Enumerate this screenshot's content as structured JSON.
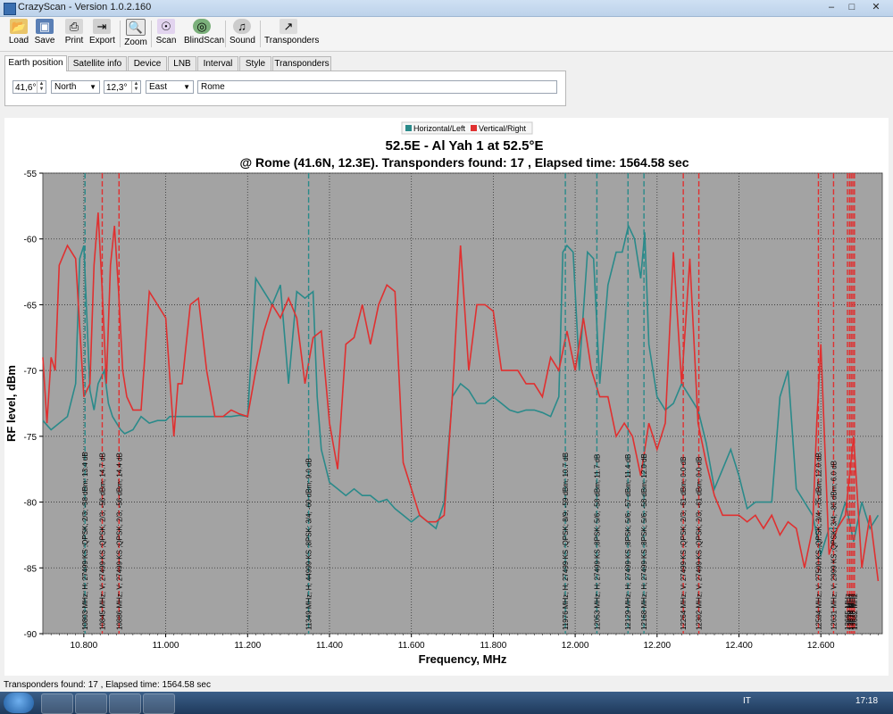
{
  "window": {
    "title": "CrazyScan - Version 1.0.2.160"
  },
  "toolbar": [
    {
      "label": "Load",
      "icon": "folder-icon"
    },
    {
      "label": "Save",
      "icon": "floppy-icon"
    },
    {
      "label": "Print",
      "icon": "printer-icon"
    },
    {
      "label": "Export",
      "icon": "export-icon"
    },
    {
      "label": "Zoom",
      "icon": "zoom-icon"
    },
    {
      "label": "Scan",
      "icon": "scan-icon"
    },
    {
      "label": "BlindScan",
      "icon": "blindscan-icon"
    },
    {
      "label": "Sound",
      "icon": "speaker-icon"
    },
    {
      "label": "Transponders",
      "icon": "transponders-icon"
    }
  ],
  "tabs": [
    "Earth position",
    "Satellite info",
    "Device",
    "LNB",
    "Interval",
    "Style",
    "Transponders"
  ],
  "earth_position": {
    "latitude": "41,6°",
    "lat_dir": "North",
    "longitude": "12,3°",
    "lon_dir": "East",
    "location": "Rome"
  },
  "chart_data": {
    "type": "line",
    "title": "52.5E - Al Yah 1 at 52.5°E",
    "subtitle": "@ Rome (41.6N, 12.3E). Transponders found: 17 , Elapsed time: 1564.58 sec",
    "xlabel": "Frequency, MHz",
    "ylabel": "RF level, dBm",
    "xlim": [
      10700,
      12750
    ],
    "ylim": [
      -90,
      -55
    ],
    "xticks": [
      "10.800",
      "11.000",
      "11.200",
      "11.400",
      "11.600",
      "11.800",
      "12.000",
      "12.200",
      "12.400",
      "12.600"
    ],
    "xtick_values": [
      10800,
      11000,
      11200,
      11400,
      11600,
      11800,
      12000,
      12200,
      12400,
      12600
    ],
    "yticks": [
      -55,
      -60,
      -65,
      -70,
      -75,
      -80,
      -85,
      -90
    ],
    "grid": true,
    "legend": [
      "Horizontal/Left",
      "Vertical/Right"
    ],
    "colors": {
      "horizontal": "#2a8a8a",
      "vertical": "#e03030",
      "plot_bg": "#a3a3a3"
    },
    "series": [
      {
        "name": "Horizontal/Left",
        "color": "#2a8a8a",
        "x": [
          10700,
          10720,
          10740,
          10760,
          10780,
          10790,
          10800,
          10815,
          10825,
          10835,
          10850,
          10860,
          10870,
          10880,
          10890,
          10900,
          10920,
          10940,
          10960,
          10980,
          11000,
          11010,
          11020,
          11040,
          11060,
          11080,
          11100,
          11120,
          11140,
          11160,
          11180,
          11200,
          11220,
          11240,
          11260,
          11280,
          11300,
          11320,
          11340,
          11360,
          11370,
          11380,
          11400,
          11420,
          11440,
          11460,
          11480,
          11500,
          11520,
          11540,
          11560,
          11580,
          11600,
          11620,
          11640,
          11660,
          11680,
          11700,
          11720,
          11740,
          11760,
          11780,
          11800,
          11820,
          11840,
          11860,
          11880,
          11900,
          11920,
          11940,
          11960,
          11970,
          11980,
          11995,
          12010,
          12030,
          12045,
          12060,
          12080,
          12100,
          12115,
          12130,
          12145,
          12160,
          12170,
          12180,
          12200,
          12220,
          12240,
          12260,
          12280,
          12300,
          12320,
          12340,
          12360,
          12380,
          12400,
          12420,
          12440,
          12460,
          12480,
          12500,
          12520,
          12540,
          12560,
          12580,
          12600,
          12620,
          12640,
          12660,
          12680,
          12700,
          12720,
          12740
        ],
        "y": [
          -73.8,
          -74.5,
          -74,
          -73.5,
          -71,
          -61.5,
          -60.5,
          -71.5,
          -73,
          -71,
          -70,
          -72.5,
          -73.5,
          -74,
          -74.5,
          -74.8,
          -74.5,
          -73.5,
          -74,
          -73.8,
          -73.8,
          -73.5,
          -73.5,
          -73.5,
          -73.5,
          -73.5,
          -73.5,
          -73.5,
          -73.5,
          -73.5,
          -73.4,
          -73.5,
          -63,
          -64,
          -65,
          -63.5,
          -71,
          -64,
          -64.5,
          -64,
          -72,
          -76,
          -78.5,
          -79,
          -79.5,
          -79,
          -79.5,
          -79.5,
          -80,
          -79.8,
          -80.5,
          -81,
          -81.5,
          -81,
          -81.5,
          -82,
          -80,
          -72,
          -71,
          -71.5,
          -72.5,
          -72.5,
          -72,
          -72.5,
          -73,
          -73.2,
          -73,
          -73,
          -73.2,
          -73.5,
          -72,
          -61,
          -60.5,
          -61,
          -70,
          -61,
          -61.5,
          -71,
          -63.5,
          -61,
          -61,
          -59,
          -60,
          -63,
          -59.5,
          -68,
          -72,
          -73,
          -72.5,
          -71,
          -72,
          -73,
          -75.5,
          -79,
          -77.5,
          -76,
          -78,
          -80.5,
          -80,
          -80,
          -80,
          -72,
          -70,
          -79,
          -80,
          -81,
          -84,
          -82,
          -82,
          -80,
          -83,
          -80,
          -82,
          -81
        ]
      },
      {
        "name": "Vertical/Right",
        "color": "#e03030",
        "x": [
          10700,
          10710,
          10720,
          10730,
          10740,
          10760,
          10780,
          10800,
          10815,
          10825,
          10835,
          10845,
          10855,
          10865,
          10875,
          10885,
          10895,
          10905,
          10920,
          10940,
          10960,
          10980,
          11000,
          11020,
          11030,
          11040,
          11060,
          11080,
          11100,
          11120,
          11140,
          11160,
          11180,
          11200,
          11220,
          11240,
          11260,
          11280,
          11300,
          11320,
          11340,
          11360,
          11380,
          11400,
          11420,
          11440,
          11460,
          11480,
          11500,
          11520,
          11540,
          11560,
          11580,
          11600,
          11620,
          11640,
          11660,
          11680,
          11700,
          11720,
          11740,
          11760,
          11780,
          11800,
          11820,
          11840,
          11860,
          11880,
          11900,
          11920,
          11940,
          11960,
          11980,
          12000,
          12020,
          12040,
          12060,
          12080,
          12100,
          12120,
          12140,
          12160,
          12180,
          12200,
          12220,
          12240,
          12260,
          12280,
          12300,
          12320,
          12340,
          12360,
          12380,
          12400,
          12420,
          12440,
          12460,
          12480,
          12500,
          12520,
          12540,
          12560,
          12580,
          12590,
          12600,
          12620,
          12640,
          12660,
          12680,
          12700,
          12720,
          12740
        ],
        "y": [
          -69,
          -74,
          -69,
          -70,
          -62,
          -60.5,
          -61.5,
          -72,
          -71,
          -62,
          -58,
          -64,
          -71,
          -62,
          -59,
          -64,
          -70,
          -72,
          -73,
          -73,
          -64,
          -65,
          -66,
          -75,
          -71,
          -71,
          -65,
          -64.5,
          -70,
          -73.5,
          -73.5,
          -73,
          -73.3,
          -73.5,
          -70,
          -67,
          -65,
          -66,
          -64.5,
          -66,
          -71,
          -67.5,
          -67,
          -74,
          -77.5,
          -68,
          -67.5,
          -65,
          -68,
          -65,
          -63.5,
          -64,
          -77,
          -79,
          -81,
          -81.5,
          -81.5,
          -81,
          -72,
          -60.5,
          -70,
          -65,
          -65,
          -65.5,
          -70,
          -70,
          -70,
          -71,
          -71,
          -72,
          -69,
          -70,
          -67,
          -70,
          -66,
          -70,
          -72,
          -72,
          -75,
          -74,
          -75,
          -78,
          -74,
          -76,
          -74,
          -61,
          -71,
          -61.5,
          -74,
          -77,
          -79.5,
          -81,
          -81,
          -81,
          -81.5,
          -81,
          -82,
          -81,
          -82.5,
          -81.5,
          -82,
          -85,
          -82,
          -74,
          -68,
          -84,
          -82,
          -81,
          -75,
          -85,
          -81,
          -86
        ]
      }
    ],
    "markers": [
      {
        "pol": "H",
        "freq": 10803,
        "label": "10803 MHz; H; 27499 KS ;QPSK; 2/3; -58 dBm; 13.4 dB"
      },
      {
        "pol": "V",
        "freq": 10845,
        "label": "10845 MHz; V; 27499 KS ;QPSK; 2/3; -56 dBm; 14.7 dB"
      },
      {
        "pol": "V",
        "freq": 10886,
        "label": "10886 MHz; V; 27499 KS ;QPSK; 2/3; -56 dBm; 14.4 dB"
      },
      {
        "pol": "H",
        "freq": 11349,
        "label": "11349 MHz; H; 44999 KS ;8PSK; 3/4; -60 dBm; 9.0 dB"
      },
      {
        "pol": "H",
        "freq": 11976,
        "label": "11976 MHz; H; 27499 KS ;QPSK; 8/9; -59 dBm; 10.7 dB"
      },
      {
        "pol": "H",
        "freq": 12053,
        "label": "12053 MHz; H; 27499 KS ;8PSK; 5/6; -58 dBm; 11.7 dB"
      },
      {
        "pol": "H",
        "freq": 12129,
        "label": "12129 MHz; H; 27499 KS ;8PSK; 5/6; -57 dBm; 11.4 dB"
      },
      {
        "pol": "H",
        "freq": 12168,
        "label": "12168 MHz; H; 27499 KS ;8PSK; 5/6; -58 dBm; 12.0 dB"
      },
      {
        "pol": "V",
        "freq": 12264,
        "label": "12264 MHz; V; 27499 KS ;QPSK; 2/3; -61 dBm; 0.0 dB"
      },
      {
        "pol": "V",
        "freq": 12302,
        "label": "12302 MHz; V; 27499 KS ;QPSK; 2/3; -61 dBm; 0.0 dB"
      },
      {
        "pol": "V",
        "freq": 12594,
        "label": "12594 MHz; V; 27500 KS ;QPSK; 3/4; -75 dBm; 12.0 dB"
      },
      {
        "pol": "V",
        "freq": 12631,
        "label": "12631 MHz; V; 2999 KS ;QPSK; 3/4; -80 dBm; 6.0 dB"
      },
      {
        "pol": "V",
        "freq": 12665,
        "label": "12665 MHz"
      },
      {
        "pol": "V",
        "freq": 12670,
        "label": "12670 MHz"
      },
      {
        "pol": "V",
        "freq": 12674,
        "label": "12674 MHz"
      },
      {
        "pol": "V",
        "freq": 12678,
        "label": "12678 MHz"
      },
      {
        "pol": "V",
        "freq": 12682,
        "label": "12682 MHz"
      }
    ]
  },
  "status": {
    "text": "Transponders found: 17 , Elapsed time: 1564.58 sec"
  },
  "taskbar": {
    "lang": "IT",
    "time": "17:18"
  }
}
